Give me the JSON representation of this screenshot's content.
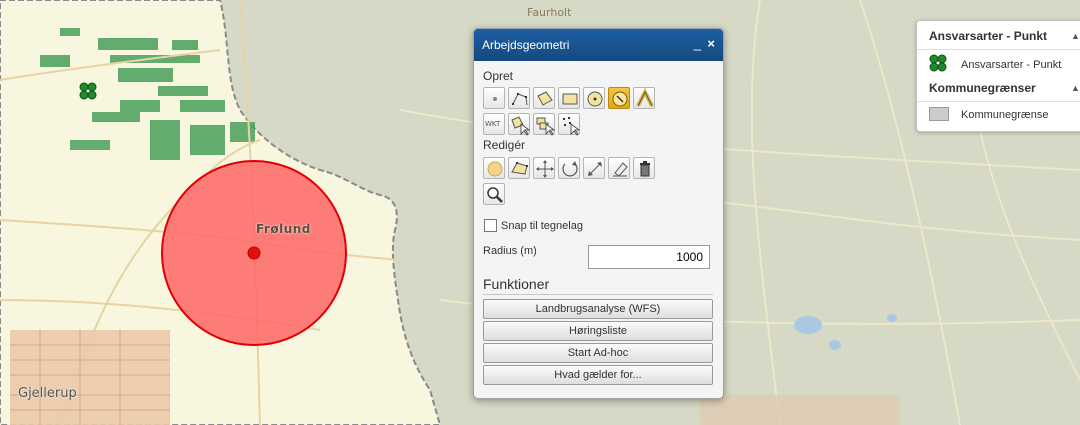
{
  "map": {
    "place_labels": {
      "frolund": "Frølund",
      "gjellerup": "Gjellerup",
      "faurholt": "Faurholt"
    },
    "icons": [
      "clover-marker-icon"
    ],
    "colors": {
      "buffer_fill": "#ff6666",
      "buffer_stroke": "#e00000",
      "municipality": "#f9f6df",
      "outside": "#d5d9c5",
      "fields": "#4aa05a"
    }
  },
  "panel": {
    "title": "Arbejdsgeometri",
    "minimize": "_",
    "close": "×",
    "create_label": "Opret",
    "create_tools": [
      "point-tool-icon",
      "line-tool-icon",
      "polygon-tool-icon",
      "rectangle-tool-icon",
      "circle-tool-icon",
      "buffer-point-tool-icon",
      "curve-tool-icon"
    ],
    "create_tools_row2": [
      "wkt-tool-icon",
      "select-polygon-tool-icon",
      "select-multi-tool-icon",
      "select-points-tool-icon"
    ],
    "wkt_text": "WKT",
    "edit_label": "Redigér",
    "edit_tools": [
      "circle-edit-icon",
      "vertex-edit-icon",
      "move-icon",
      "rotate-icon",
      "scale-icon",
      "eraser-icon",
      "trash-icon"
    ],
    "zoom_tool": "zoom-icon",
    "snap_label": "Snap til tegnelag",
    "snap_checked": false,
    "radius_label": "Radius (m)",
    "radius_value": "1000",
    "functions_title": "Funktioner",
    "functions": [
      "Landbrugsanalyse (WFS)",
      "Høringsliste",
      "Start Ad-hoc",
      "Hvad gælder for..."
    ],
    "colors": {
      "header": "#1d5fa3",
      "active_tool": "#f0b429"
    }
  },
  "legend": {
    "group1_title": "Ansvarsarter - Punkt",
    "group1_item": "Ansvarsarter - Punkt",
    "group2_title": "Kommunegrænser",
    "group2_item": "Kommunegrænse",
    "chevron": "▲"
  }
}
